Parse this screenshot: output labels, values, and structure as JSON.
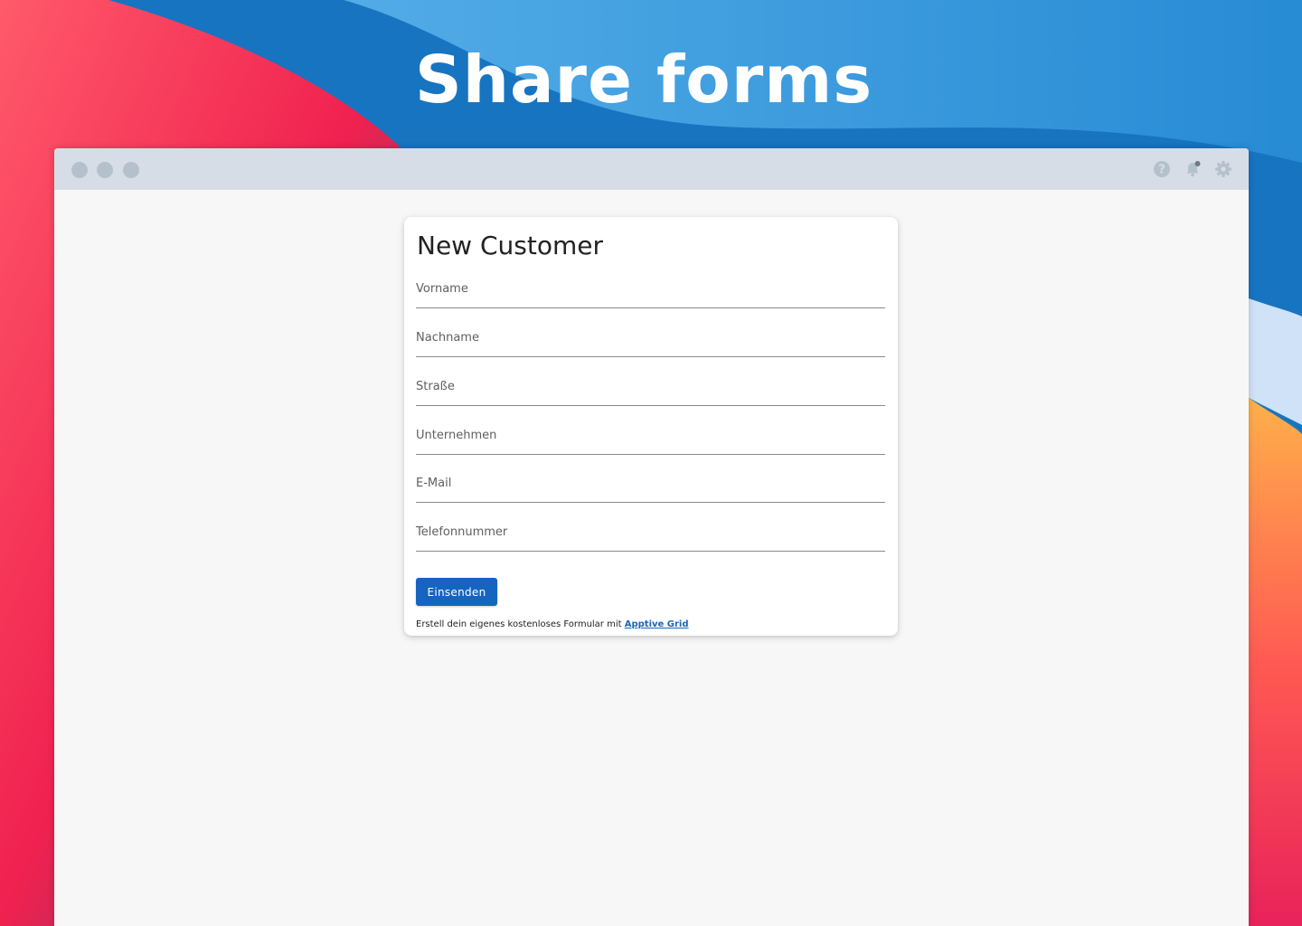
{
  "headline": "Share forms",
  "colors": {
    "accent": "#1565c0",
    "titlebar": "#d7dde7",
    "window_bg": "#f7f7f7"
  },
  "titlebar": {
    "icons": [
      "help-icon",
      "notification-bell-icon",
      "settings-gear-icon"
    ]
  },
  "form": {
    "title": "New Customer",
    "fields": [
      {
        "label": "Vorname",
        "value": ""
      },
      {
        "label": "Nachname",
        "value": ""
      },
      {
        "label": "Straße",
        "value": ""
      },
      {
        "label": "Unternehmen",
        "value": ""
      },
      {
        "label": "E-Mail",
        "value": ""
      },
      {
        "label": "Telefonnummer",
        "value": ""
      }
    ],
    "submit_label": "Einsenden",
    "footer_text": "Erstell dein eigenes kostenloses Formular mit",
    "footer_link": "Apptive Grid"
  }
}
